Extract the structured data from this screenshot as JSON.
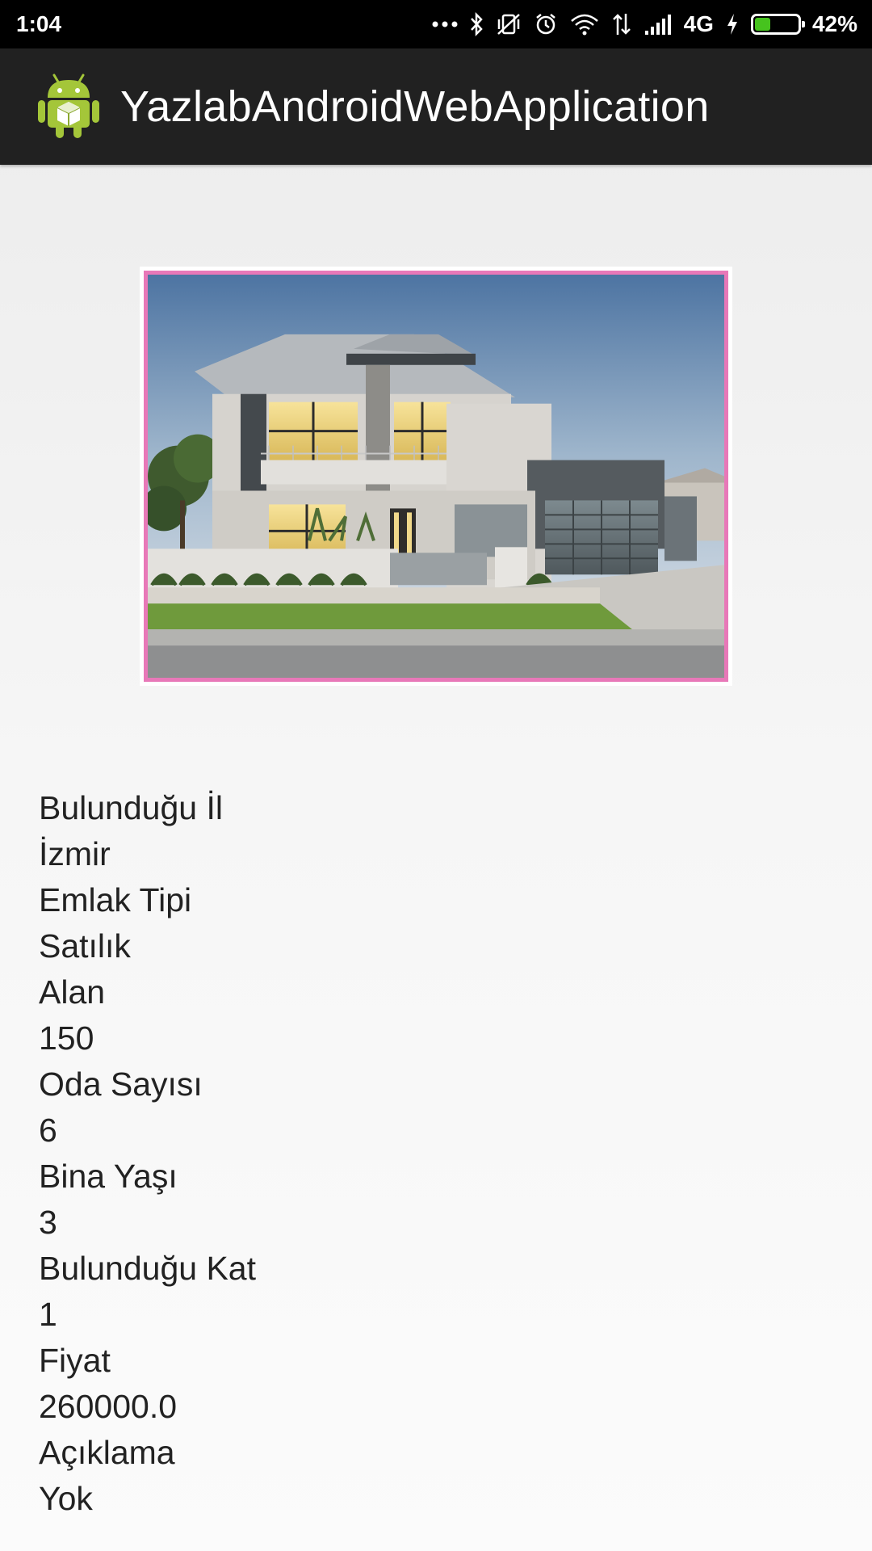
{
  "status_bar": {
    "time": "1:04",
    "network": "4G",
    "battery_percent": "42%",
    "battery_level": 0.42,
    "icons": [
      "more-dots-icon",
      "bluetooth-icon",
      "vibrate-off-icon",
      "alarm-icon",
      "wifi-icon",
      "data-transfer-icon",
      "signal-icon",
      "charging-icon",
      "battery-icon"
    ]
  },
  "app_bar": {
    "icon": "android-icon",
    "title": "YazlabAndroidWebApplication"
  },
  "image": {
    "name": "house-photo",
    "border_color": "#e878b8"
  },
  "details": [
    {
      "label": "Bulunduğu İl",
      "value": "İzmir"
    },
    {
      "label": "Emlak Tipi",
      "value": "Satılık"
    },
    {
      "label": "Alan",
      "value": "150"
    },
    {
      "label": "Oda Sayısı",
      "value": "6"
    },
    {
      "label": "Bina Yaşı",
      "value": "3"
    },
    {
      "label": "Bulunduğu Kat",
      "value": "1"
    },
    {
      "label": "Fiyat",
      "value": "260000.0"
    },
    {
      "label": "Açıklama",
      "value": "Yok"
    }
  ],
  "colors": {
    "status_bar_bg": "#000000",
    "app_bar_bg": "#212121",
    "android_green": "#a4c639",
    "text": "#222222"
  }
}
